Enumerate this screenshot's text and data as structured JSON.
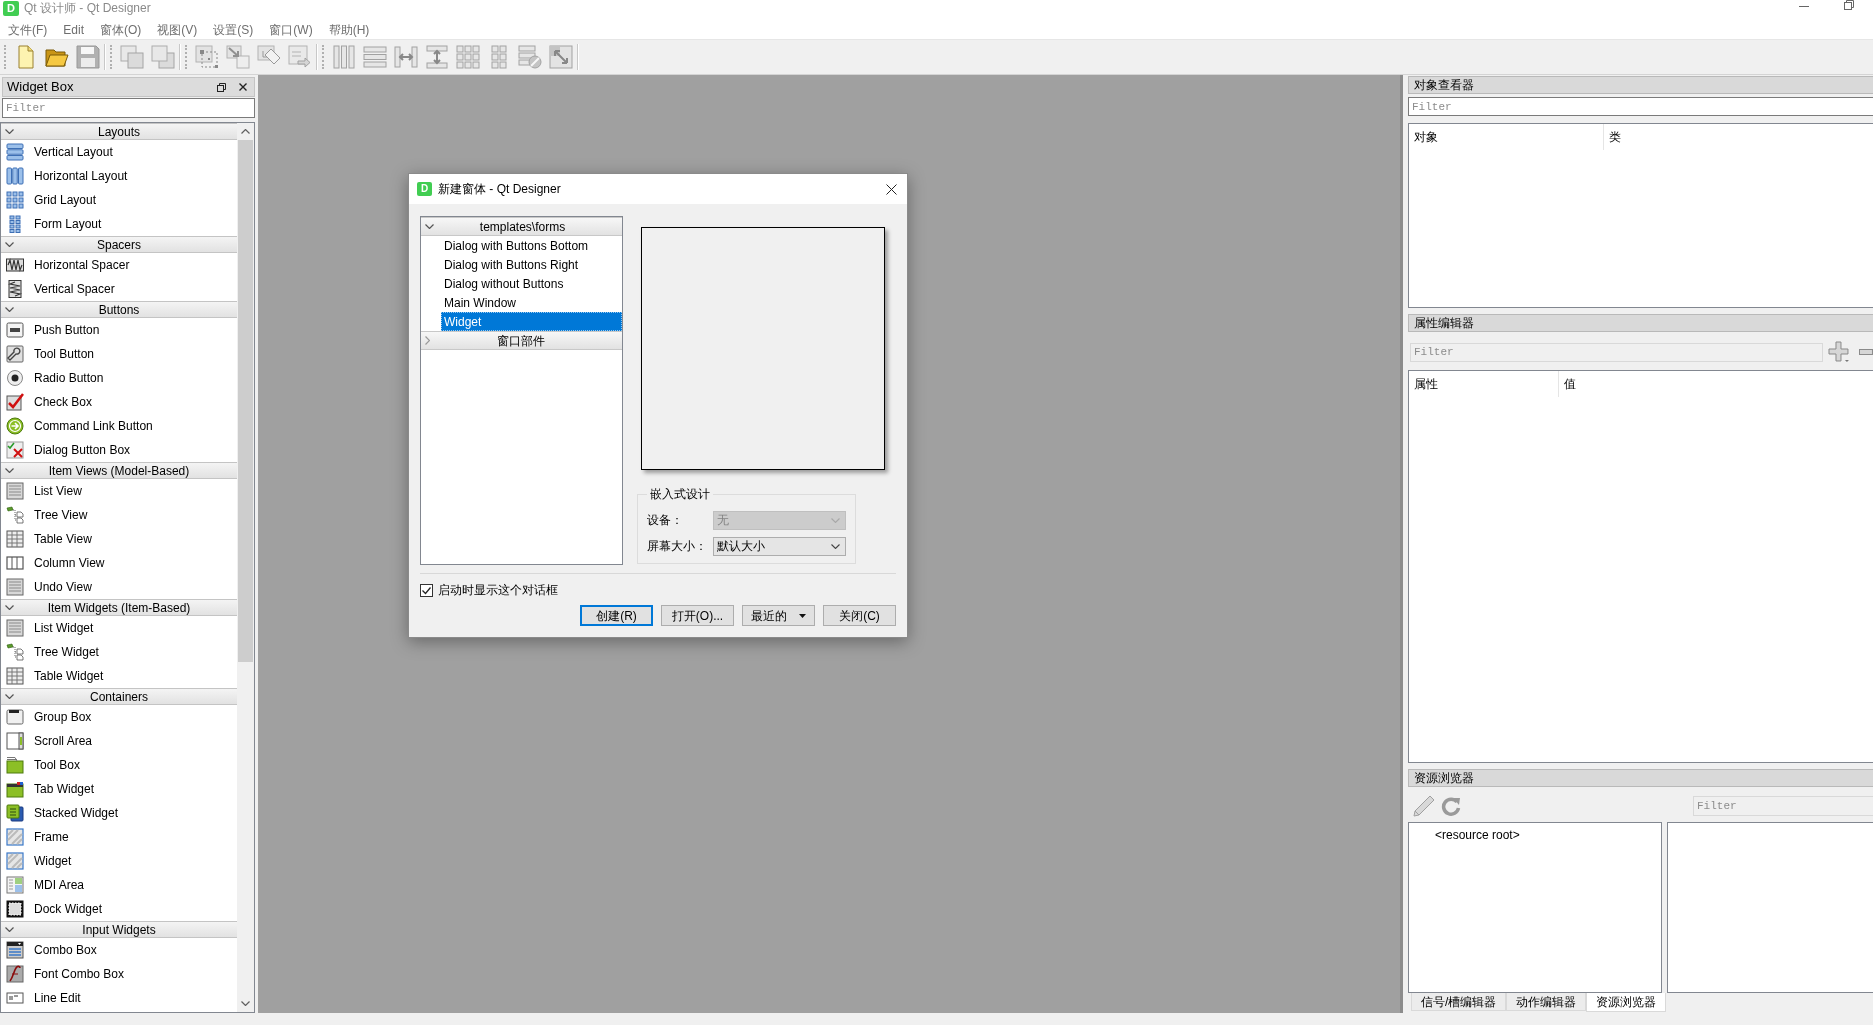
{
  "window": {
    "app_icon": "D",
    "title": "Qt 设计师 - Qt Designer"
  },
  "menu_bar": [
    "文件(F)",
    "Edit",
    "窗体(O)",
    "视图(V)",
    "设置(S)",
    "窗口(W)",
    "帮助(H)"
  ],
  "toolbar": {
    "groups": [
      {
        "items": [
          {
            "disabled": false
          },
          {
            "disabled": false
          },
          {
            "disabled": true
          }
        ]
      },
      {
        "items": [
          {
            "disabled": true
          },
          {
            "disabled": true
          }
        ]
      },
      {
        "items": [
          {
            "disabled": true
          },
          {
            "disabled": true
          },
          {
            "disabled": true
          },
          {
            "disabled": true
          }
        ]
      },
      {
        "items": [
          {
            "disabled": true
          },
          {
            "disabled": true
          },
          {
            "disabled": true
          },
          {
            "disabled": true
          },
          {
            "disabled": true
          },
          {
            "disabled": true
          },
          {
            "disabled": true
          },
          {
            "disabled": true
          }
        ]
      }
    ]
  },
  "widget_box": {
    "title": "Widget Box",
    "filter": {
      "placeholder": "Filter",
      "disabled": false
    },
    "categories": [
      {
        "label": "Layouts",
        "expanded": true,
        "items": [
          "Vertical Layout",
          "Horizontal Layout",
          "Grid Layout",
          "Form Layout"
        ]
      },
      {
        "label": "Spacers",
        "expanded": true,
        "items": [
          "Horizontal Spacer",
          "Vertical Spacer"
        ]
      },
      {
        "label": "Buttons",
        "expanded": true,
        "items": [
          "Push Button",
          "Tool Button",
          "Radio Button",
          "Check Box",
          "Command Link Button",
          "Dialog Button Box"
        ]
      },
      {
        "label": "Item Views (Model-Based)",
        "expanded": true,
        "items": [
          "List View",
          "Tree View",
          "Table View",
          "Column View",
          "Undo View"
        ]
      },
      {
        "label": "Item Widgets (Item-Based)",
        "expanded": true,
        "items": [
          "List Widget",
          "Tree Widget",
          "Table Widget"
        ]
      },
      {
        "label": "Containers",
        "expanded": true,
        "items": [
          "Group Box",
          "Scroll Area",
          "Tool Box",
          "Tab Widget",
          "Stacked Widget",
          "Frame",
          "Widget",
          "MDI Area",
          "Dock Widget"
        ]
      },
      {
        "label": "Input Widgets",
        "expanded": true,
        "items": [
          "Combo Box",
          "Font Combo Box",
          "Line Edit"
        ]
      }
    ]
  },
  "new_form_dialog": {
    "app_icon": "D",
    "title": "新建窗体 - Qt Designer",
    "template_tree": [
      {
        "label": "templates\\forms",
        "expanded": true,
        "children": [
          {
            "label": "Dialog with Buttons Bottom",
            "selected": false
          },
          {
            "label": "Dialog with Buttons Right",
            "selected": false
          },
          {
            "label": "Dialog without Buttons",
            "selected": false
          },
          {
            "label": "Main Window",
            "selected": false
          },
          {
            "label": "Widget",
            "selected": true
          }
        ]
      },
      {
        "label": "窗口部件",
        "expanded": false
      }
    ],
    "embedded_design": {
      "title": "嵌入式设计",
      "fields": [
        {
          "label": "设备：",
          "value": "无",
          "disabled": true
        },
        {
          "label": "屏幕大小：",
          "value": "默认大小",
          "disabled": false
        }
      ]
    },
    "show_on_startup": {
      "label": "启动时显示这个对话框",
      "checked": true
    },
    "buttons": [
      {
        "label": "创建(R)",
        "default": true,
        "has_menu": false
      },
      {
        "label": "打开(O)...",
        "default": false,
        "has_menu": false
      },
      {
        "label": "最近的",
        "default": false,
        "has_menu": true
      },
      {
        "label": "关闭(C)",
        "default": false,
        "has_menu": false
      }
    ]
  },
  "object_inspector": {
    "title": "对象查看器",
    "filter": {
      "placeholder": "Filter",
      "disabled": false
    },
    "columns": [
      "对象",
      "类"
    ]
  },
  "property_editor": {
    "title": "属性编辑器",
    "filter": {
      "placeholder": "Filter",
      "disabled": true
    },
    "columns": [
      "属性",
      "值"
    ]
  },
  "resource_browser": {
    "title": "资源浏览器",
    "filter": {
      "placeholder": "Filter",
      "disabled": true
    },
    "tree": [
      "<resource root>"
    ]
  },
  "dock_tabs": [
    {
      "label": "信号/槽编辑器",
      "selected": false
    },
    {
      "label": "动作编辑器",
      "selected": false
    },
    {
      "label": "资源浏览器",
      "selected": true
    }
  ]
}
